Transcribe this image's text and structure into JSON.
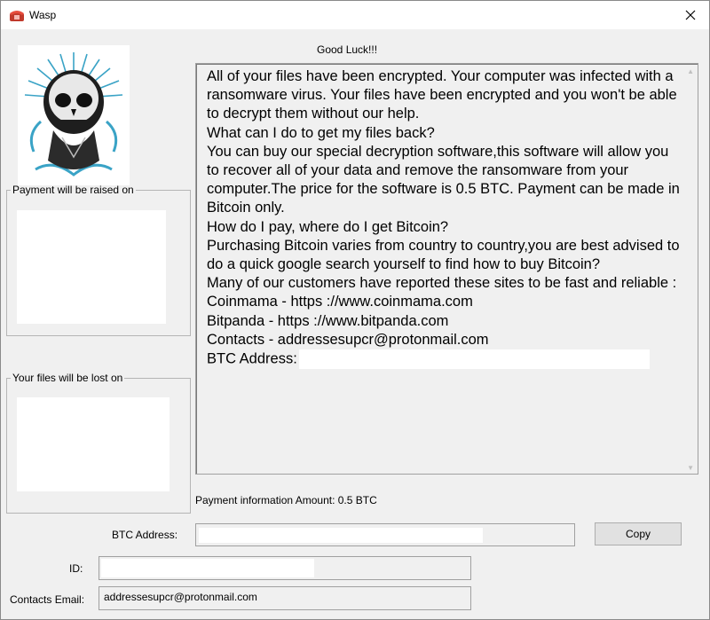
{
  "window": {
    "title": "Wasp",
    "app_icon": "telephone-icon",
    "close_icon": "close-icon"
  },
  "header": {
    "good_luck": "Good Luck!!!"
  },
  "logo": {
    "icon": "skull-logo-icon"
  },
  "groups": {
    "payment_raised": "Payment will be raised on",
    "files_lost": "Your files will be lost on"
  },
  "message": {
    "lines": [
      "All of your files have been encrypted. Your computer was infected with a ransomware virus. Your files have been encrypted and you won't be able to decrypt them without our help.",
      "What can I do to get my files back?",
      "You can buy our special decryption software,this software will allow you to recover all of your data and remove the ransomware from your computer.The price for the software is 0.5 BTC. Payment can be made in Bitcoin only.",
      "How do I pay, where do I get Bitcoin?",
      "Purchasing Bitcoin varies from country to country,you are best advised to do a quick google search yourself to find how to buy Bitcoin?",
      "Many of our customers have reported these sites to be fast and reliable :",
      "Coinmama - https ://www.coinmama.com",
      "Bitpanda - https ://www.bitpanda.com",
      "Contacts - addressesupcr@protonmail.com"
    ],
    "btc_label": "BTC Address:"
  },
  "payment_info": "Payment information Amount: 0.5 BTC",
  "form": {
    "btc_label": "BTC Address:",
    "copy_label": "Copy",
    "id_label": "ID:",
    "email_label": "Contacts Email:",
    "email_value": "addressesupcr@protonmail.com"
  }
}
